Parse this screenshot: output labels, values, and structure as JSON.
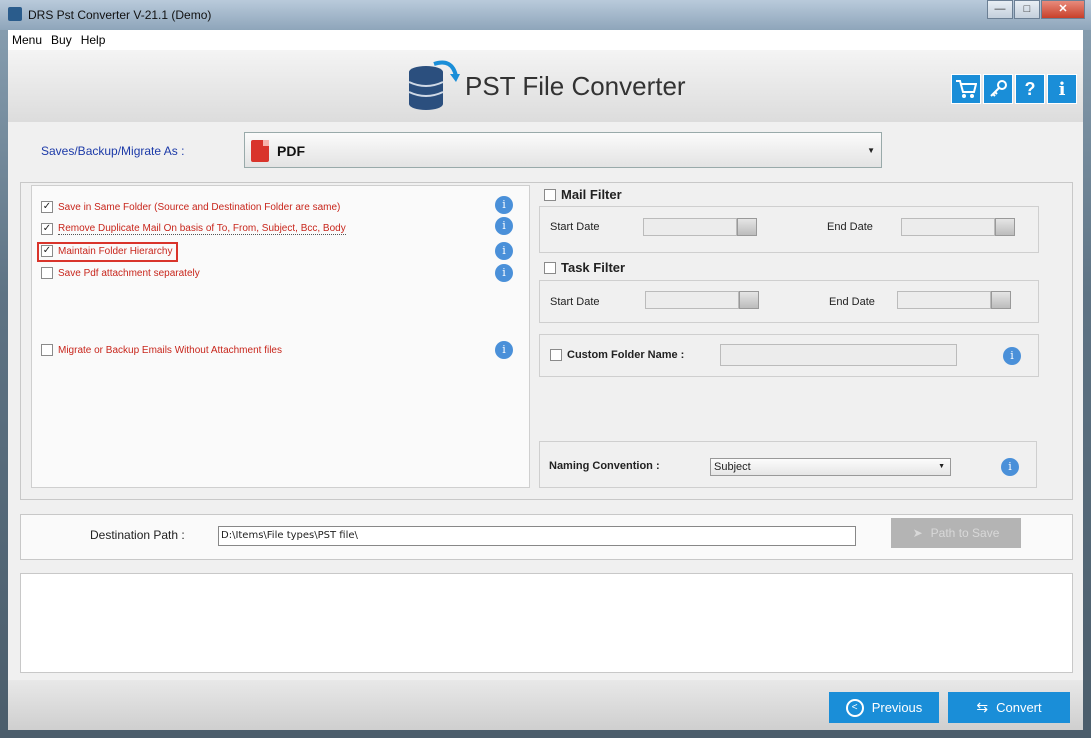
{
  "window": {
    "title": "DRS Pst Converter V-21.1 (Demo)",
    "minimize": "—",
    "maximize": "□",
    "close": "✕"
  },
  "menu": [
    "Menu",
    "Buy",
    "Help"
  ],
  "header": {
    "app_title": "PST File Converter",
    "icons": [
      "cart-icon",
      "key-icon",
      "help-icon",
      "info-icon"
    ]
  },
  "saveas": {
    "label": "Saves/Backup/Migrate As :",
    "selected": "PDF"
  },
  "options": {
    "same_folder": {
      "label": "Save in Same Folder (Source and Destination Folder are same)",
      "checked": true
    },
    "remove_duplicate": {
      "label": "Remove Duplicate Mail On basis of To, From, Subject, Bcc, Body",
      "checked": true
    },
    "maintain_hierarchy": {
      "label": "Maintain Folder Hierarchy",
      "checked": true
    },
    "save_pdf_attach": {
      "label": "Save Pdf attachment separately",
      "checked": false
    },
    "no_attachment": {
      "label": "Migrate or Backup Emails Without Attachment files",
      "checked": false
    }
  },
  "mail_filter": {
    "title": "Mail Filter",
    "start": "Start Date",
    "end": "End Date"
  },
  "task_filter": {
    "title": "Task Filter",
    "start": "Start Date",
    "end": "End Date"
  },
  "custom_folder": {
    "label": "Custom Folder Name :"
  },
  "naming": {
    "label": "Naming Convention :",
    "selected": "Subject"
  },
  "destination": {
    "label": "Destination Path :",
    "value": "D:\\Items\\File types\\PST file\\",
    "button": "Path to Save"
  },
  "footer": {
    "previous": "Previous",
    "convert": "Convert"
  },
  "colors": {
    "accent": "#1a8ed8",
    "option_text": "#c8261c",
    "saveas_label": "#1c3aa8"
  }
}
